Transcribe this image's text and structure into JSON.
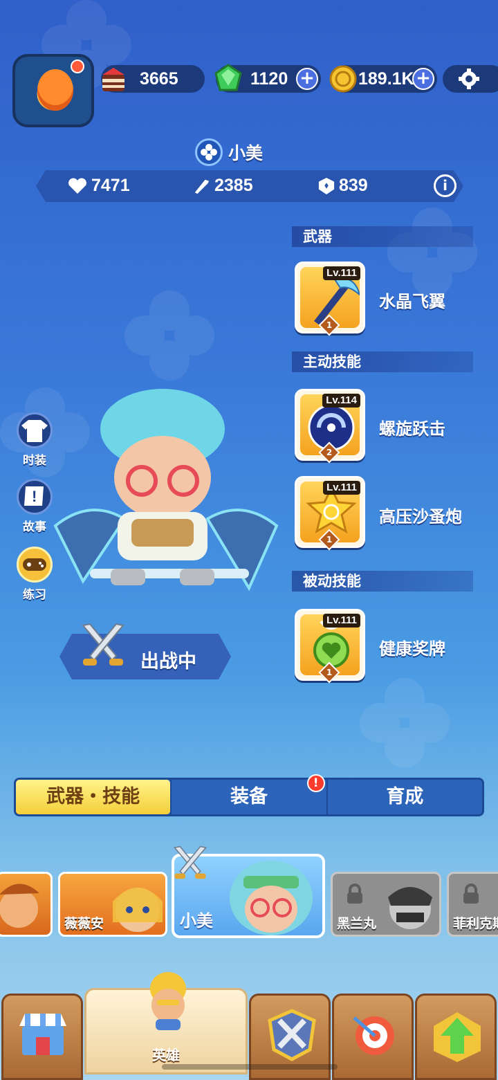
{
  "top_bar": {
    "cake_count": "3665",
    "gem_count": "1120",
    "coin_count": "189.1K",
    "plus_label": "+"
  },
  "hero": {
    "name": "小美",
    "stats": {
      "health": "7471",
      "attack": "2385",
      "armor": "839"
    },
    "info_label": "i"
  },
  "loadout": {
    "weapon_section": "武器",
    "weapon": {
      "name": "水晶飞翼",
      "level": "Lv.111",
      "tier": "1"
    },
    "active_section": "主动技能",
    "active_skills": [
      {
        "name": "螺旋跃击",
        "level": "Lv.114",
        "tier": "2"
      },
      {
        "name": "高压沙蚤炮",
        "level": "Lv.111",
        "tier": "1"
      }
    ],
    "passive_section": "被动技能",
    "passive_skill": {
      "name": "健康奖牌",
      "level": "Lv.111",
      "tier": "1"
    }
  },
  "side_menu": [
    "时装",
    "故事",
    "练习"
  ],
  "battle_status": "出战中",
  "tabs": [
    {
      "label": "武器・技能",
      "active": true
    },
    {
      "label": "装备",
      "alert": "!"
    },
    {
      "label": "育成"
    }
  ],
  "hero_cards": [
    {
      "name": ""
    },
    {
      "name": "薇薇安"
    },
    {
      "name": "小美",
      "selected": true
    },
    {
      "name": "黑兰丸",
      "locked": true
    },
    {
      "name": "菲利克斯",
      "locked": true
    }
  ],
  "bottom_nav": [
    {
      "label": "",
      "icon": "shop-icon"
    },
    {
      "label": "英雄",
      "icon": "hero-icon",
      "active": true
    },
    {
      "label": "",
      "icon": "battle-icon"
    },
    {
      "label": "",
      "icon": "target-icon"
    },
    {
      "label": "",
      "icon": "upgrade-arrow-icon"
    }
  ],
  "colors": {
    "bg_top": "#2f5fc9",
    "bg_bottom": "#a9d6f0",
    "active_tab": "#f5cf3a",
    "alert": "#ff3b2e"
  }
}
